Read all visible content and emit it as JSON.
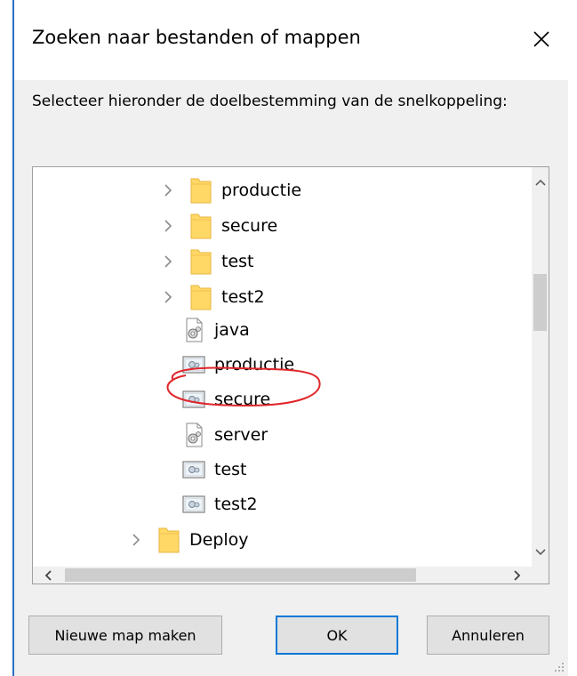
{
  "dialog": {
    "title": "Zoeken naar bestanden of mappen",
    "close_icon": "close-icon",
    "prompt": "Selecteer hieronder de doelbestemming van de snelkoppeling:"
  },
  "tree": {
    "items": [
      {
        "label": "productie",
        "type": "folder",
        "expandable": true
      },
      {
        "label": "secure",
        "type": "folder",
        "expandable": true
      },
      {
        "label": "test",
        "type": "folder",
        "expandable": true
      },
      {
        "label": "test2",
        "type": "folder",
        "expandable": true
      },
      {
        "label": "java",
        "type": "settings-file",
        "expandable": false
      },
      {
        "label": "productie",
        "type": "config-file",
        "expandable": false
      },
      {
        "label": "secure",
        "type": "config-file",
        "expandable": false,
        "annotated": true
      },
      {
        "label": "server",
        "type": "settings-file",
        "expandable": false
      },
      {
        "label": "test",
        "type": "config-file",
        "expandable": false
      },
      {
        "label": "test2",
        "type": "config-file",
        "expandable": false
      },
      {
        "label": "Deploy",
        "type": "folder",
        "expandable": true
      }
    ]
  },
  "buttons": {
    "new_folder": "Nieuwe map maken",
    "ok": "OK",
    "cancel": "Annuleren"
  },
  "colors": {
    "accent": "#0078d7",
    "folder": "#ffd866",
    "annotation": "#e0262b"
  }
}
